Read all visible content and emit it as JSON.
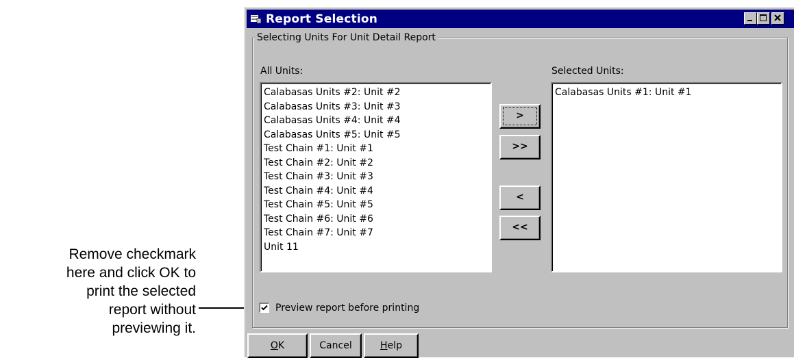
{
  "annotation": {
    "lines": [
      "Remove checkmark",
      "here and click OK to",
      "print the selected",
      "report without",
      "previewing it."
    ]
  },
  "window": {
    "title": "Report Selection",
    "icon": "report-window-icon",
    "controls": [
      "minimize-icon",
      "maximize-icon",
      "close-icon"
    ]
  },
  "group": {
    "legend": "Selecting Units For Unit Detail Report",
    "all_units_label": "All Units:",
    "selected_units_label": "Selected Units:",
    "all_units": [
      "Calabasas Units #2: Unit #2",
      "Calabasas Units #3: Unit #3",
      "Calabasas Units #4: Unit #4",
      "Calabasas Units #5: Unit #5",
      "Test Chain #1: Unit #1",
      "Test Chain #2: Unit #2",
      "Test Chain #3: Unit #3",
      "Test Chain #4: Unit #4",
      "Test Chain #5: Unit #5",
      "Test Chain #6: Unit #6",
      "Test Chain #7: Unit #7",
      "Unit 11"
    ],
    "selected_units": [
      "Calabasas Units #1: Unit #1"
    ],
    "buttons": {
      "add": ">",
      "add_all": ">>",
      "remove": "<",
      "remove_all": "<<"
    },
    "preview_checkbox": {
      "label": "Preview report before printing",
      "checked": true
    }
  },
  "footer": {
    "ok": "OK",
    "cancel": "Cancel",
    "help": "Help"
  }
}
